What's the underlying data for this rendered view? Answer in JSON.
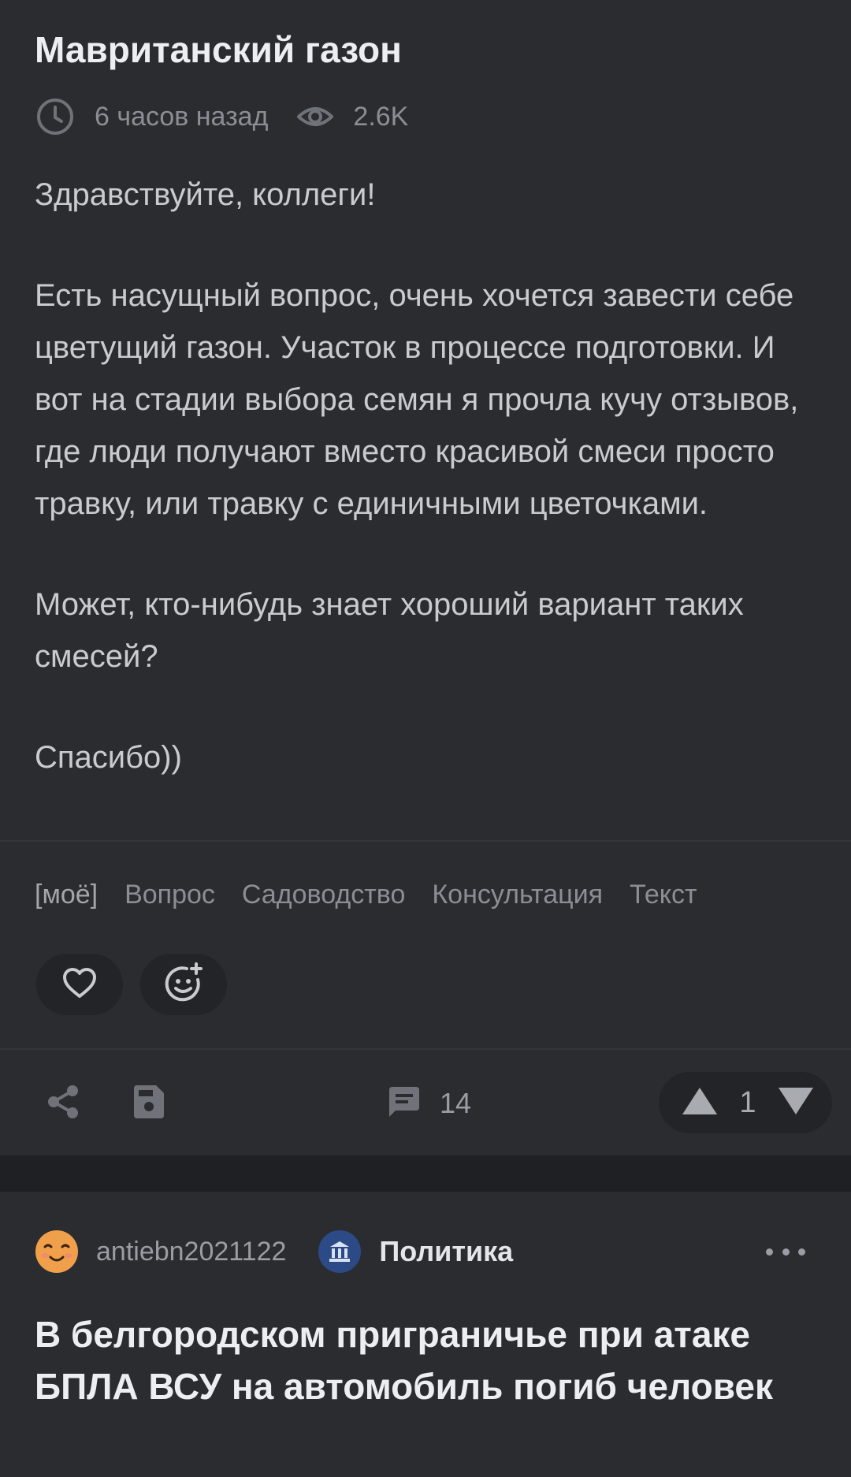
{
  "post": {
    "title": "Мавританский газон",
    "time": "6 часов назад",
    "views": "2.6K",
    "paragraphs": [
      "Здравствуйте, коллеги!",
      "Есть насущный вопрос, очень хочется завести себе цветущий газон. Участок в процессе подготовки. И вот на стадии выбора семян я прочла кучу отзывов, где люди получают вместо красивой смеси просто травку, или травку с единичными цветочками.",
      "Может, кто-нибудь знает хороший вариант таких смесей?",
      "Спасибо))"
    ],
    "tags": [
      "[моё]",
      "Вопрос",
      "Садоводство",
      "Консультация",
      "Текст"
    ],
    "comments_count": "14",
    "rating": "1",
    "icons": {
      "time": "clock-icon",
      "views": "eye-icon",
      "like": "heart-icon",
      "reaction": "add-emoji-icon",
      "share": "share-icon",
      "save": "save-icon",
      "comments": "comment-icon",
      "upvote": "triangle-up-icon",
      "downvote": "triangle-down-icon"
    }
  },
  "next_post": {
    "author": "antiebn2021122",
    "community": "Политика",
    "title": "В белгородском приграничье при атаке БПЛА ВСУ на автомобиль погиб человек",
    "icons": {
      "avatar": "smiley-avatar-icon",
      "community": "government-building-icon",
      "more": "more-dots-icon"
    }
  },
  "colors": {
    "background": "#1f2023",
    "card": "#2b2c30",
    "text_primary": "#eceef1",
    "text_secondary": "#8b8e94",
    "community_badge": "#2c4a86",
    "avatar": "#f0a04b"
  }
}
